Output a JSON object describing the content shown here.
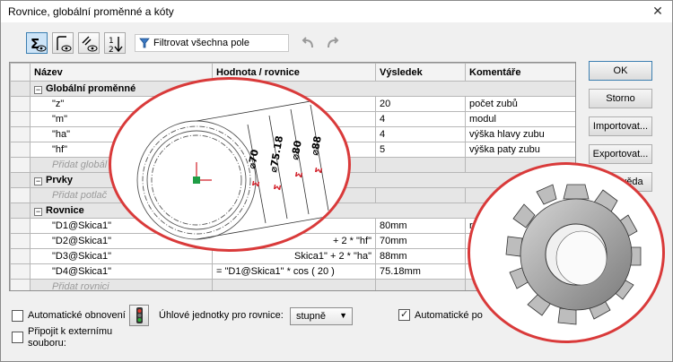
{
  "window": {
    "title": "Rovnice, globální proměnné a kóty"
  },
  "toolbar": {
    "buttons": [
      {
        "name": "equation-view-button",
        "icon": "sigma-eye-icon",
        "active": true
      },
      {
        "name": "sketch-equation-view-button",
        "icon": "sketch-eye-icon",
        "active": false
      },
      {
        "name": "dimension-view-button",
        "icon": "dimension-eye-icon",
        "active": false
      },
      {
        "name": "ordered-view-button",
        "icon": "ordered-list-icon",
        "active": false
      }
    ],
    "filter_label": "Filtrovat všechna pole",
    "undo_icon": "undo-icon",
    "redo_icon": "redo-icon"
  },
  "grid": {
    "headers": [
      "Název",
      "Hodnota / rovnice",
      "Výsledek",
      "Komentáře"
    ],
    "groups": {
      "globals": {
        "label": "Globální proměnné",
        "rows": [
          {
            "name": "\"z\"",
            "value": "",
            "result": "20",
            "comment": "počet zubů"
          },
          {
            "name": "\"m\"",
            "value": "",
            "result": "4",
            "comment": "modul"
          },
          {
            "name": "\"ha\"",
            "value": "",
            "result": "4",
            "comment": "výška hlavy zubu"
          },
          {
            "name": "\"hf\"",
            "value": "",
            "result": "5",
            "comment": "výška paty zubu"
          }
        ],
        "add_placeholder": "Přidat globál"
      },
      "features": {
        "label": "Prvky",
        "add_placeholder": "Přidat potlač"
      },
      "equations": {
        "label": "Rovnice",
        "rows": [
          {
            "name": "\"D1@Skica1\"",
            "value": "",
            "result": "80mm",
            "comment": "ro"
          },
          {
            "name": "\"D2@Skica1\"",
            "value": "+ 2 * \"hf\"",
            "result": "70mm",
            "comment": "p"
          },
          {
            "name": "\"D3@Skica1\"",
            "value": "Skica1\" + 2 * \"ha\"",
            "result": "88mm",
            "comment": ""
          },
          {
            "name": "\"D4@Skica1\"",
            "value": "= \"D1@Skica1\" * cos ( 20 )",
            "result": "75.18mm",
            "comment": ""
          }
        ],
        "add_placeholder": "Přidat rovnici"
      }
    }
  },
  "side_buttons": {
    "ok": "OK",
    "cancel": "Storno",
    "import": "Importovat...",
    "export": "Exportovat...",
    "help": "Nápověda"
  },
  "bottom": {
    "auto_rebuild": {
      "label": "Automatické obnovení",
      "checked": false
    },
    "angle_units_label": "Úhlové jednotky pro rovnice:",
    "angle_units_value": "stupně",
    "auto_solve": {
      "label": "Automatické po",
      "checked": true
    },
    "link_external": {
      "label_line1": "Připojit k externímu",
      "label_line2": "souboru:",
      "checked": false
    }
  },
  "callout_sketch": {
    "dimensions": [
      "⌀70",
      "⌀75.18",
      "⌀80",
      "⌀88"
    ],
    "equation_symbol": "Σ"
  },
  "colors": {
    "callout_border": "#d93a3a",
    "dim_red": "#d2202a",
    "selection_blue": "#cde4f7"
  }
}
